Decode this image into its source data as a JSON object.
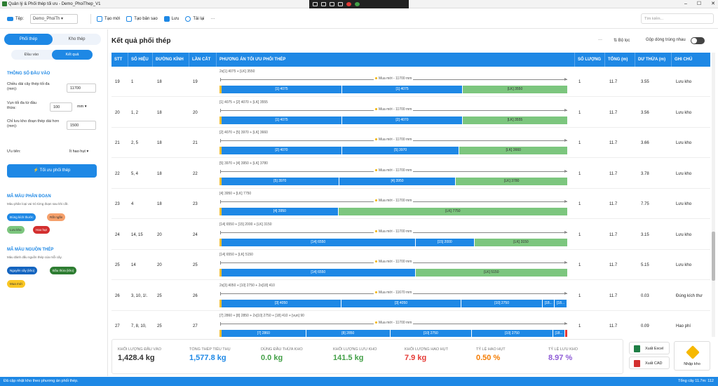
{
  "window": {
    "title": "Quản lý & Phối thép tối ưu - Demo_PhoiThep_V1"
  },
  "toolbar": {
    "file_label": "Tệp:",
    "file_value": "Demo_PhoiTh",
    "new": "Tạo mới",
    "copy": "Tạo bản sao",
    "save": "Lưu",
    "reload": "Tải lại",
    "more": "···",
    "search_placeholder": "Tìm kiếm..."
  },
  "sidebar": {
    "tab_phoi": "Phối thép",
    "tab_kho": "Kho thép",
    "sub_input": "Đầu vào",
    "sub_result": "Kết quả",
    "params_title": "THÔNG SỐ ĐẦU VÀO",
    "f1_label": "Chiều dài cây thép tối đa (mm):",
    "f1_value": "11700",
    "f2_label": "Vụn tối đa từ đầu thừa:",
    "f2_value": "100",
    "f2_unit": "mm",
    "f3_label": "Chỉ lưu kho đoạn thép dài hơn (mm):",
    "f3_value": "1500",
    "f4_label": "Ưu tiên:",
    "f4_value": "Ít hao hụt",
    "optimize_btn": "Tối ưu phối thép",
    "seg_title": "MÃ MÀU PHÂN ĐOẠN",
    "seg_note": "Màu phân loại vai trò từng đoạn sau khi cắt.",
    "chip_correct": "Đúng kích thước",
    "chip_short": "Rất ngắn",
    "chip_store": "Lưu kho",
    "chip_loss": "Hao hụt",
    "src_title": "MÃ MÀU NGUỒN THÉP",
    "src_note": "Màu đánh dấu nguồn thép của mỗi cây.",
    "chip_whole": "Nguyên cây (kho)",
    "chip_leftover": "Đầu thừa (kho)",
    "chip_new": "Mua mới"
  },
  "main": {
    "title": "Kết quả phối thép",
    "more": "···",
    "filter": "Bộ lọc",
    "merge": "Gộp dòng trùng nhau"
  },
  "table": {
    "headers": [
      "STT",
      "SỐ HIỆU",
      "ĐƯỜNG KÍNH",
      "LẦN CẮT",
      "PHƯƠNG ÁN TỐI ƯU PHỐI THÉP",
      "SỐ LƯỢNG",
      "TỔNG (m)",
      "DƯ THỪA (m)",
      "GHI CHÚ"
    ],
    "rows": [
      {
        "stt": "19",
        "so_hieu": "1",
        "dk": "18",
        "lan": "19",
        "text": "2x[1] 4075 + [LK] 3550",
        "cap": "Mua mới - 11700 mm",
        "segs": [
          [
            "[1] 4075",
            4075,
            "blue"
          ],
          [
            "[1] 4075",
            4075,
            "blue"
          ],
          [
            "[LK] 3550",
            3550,
            "green"
          ]
        ],
        "sl": "1",
        "tong": "11.7",
        "du": "3.55",
        "note": "Lưu kho"
      },
      {
        "stt": "20",
        "so_hieu": "1, 2",
        "dk": "18",
        "lan": "20",
        "text": "[1] 4075 + [2] 4070 + [LK] 3555",
        "cap": "Mua mới - 11700 mm",
        "segs": [
          [
            "[1] 4075",
            4075,
            "blue"
          ],
          [
            "[2] 4070",
            4070,
            "blue"
          ],
          [
            "[LK] 3555",
            3555,
            "green"
          ]
        ],
        "sl": "1",
        "tong": "11.7",
        "du": "3.56",
        "note": "Lưu kho"
      },
      {
        "stt": "21",
        "so_hieu": "2, 5",
        "dk": "18",
        "lan": "21",
        "text": "[2] 4070 + [5] 3970 + [LK] 3660",
        "cap": "Mua mới - 11700 mm",
        "segs": [
          [
            "[2] 4070",
            4070,
            "blue"
          ],
          [
            "[5] 3970",
            3970,
            "blue"
          ],
          [
            "[LK] 3660",
            3660,
            "green"
          ]
        ],
        "sl": "1",
        "tong": "11.7",
        "du": "3.66",
        "note": "Lưu kho"
      },
      {
        "stt": "22",
        "so_hieu": "5, 4",
        "dk": "18",
        "lan": "22",
        "text": "[5] 3970 + [4] 3950 + [LK] 3780",
        "cap": "Mua mới - 11700 mm",
        "segs": [
          [
            "[5] 3970",
            3970,
            "blue"
          ],
          [
            "[4] 3950",
            3950,
            "blue"
          ],
          [
            "[LK] 3780",
            3780,
            "green"
          ]
        ],
        "sl": "1",
        "tong": "11.7",
        "du": "3.78",
        "note": "Lưu kho"
      },
      {
        "stt": "23",
        "so_hieu": "4",
        "dk": "18",
        "lan": "23",
        "text": "[4] 3950 + [LK] 7750",
        "cap": "Mua mới - 11700 mm",
        "segs": [
          [
            "[4] 3950",
            3950,
            "blue"
          ],
          [
            "[LK] 7750",
            7750,
            "green"
          ]
        ],
        "sl": "1",
        "tong": "11.7",
        "du": "7.75",
        "note": "Lưu kho"
      },
      {
        "stt": "24",
        "so_hieu": "14, 15",
        "dk": "20",
        "lan": "24",
        "text": "[14] 6550 + [15] 2000 + [LK] 3150",
        "cap": "Mua mới - 11700 mm",
        "segs": [
          [
            "[14] 6550",
            6550,
            "blue"
          ],
          [
            "[15] 2000",
            2000,
            "blue"
          ],
          [
            "[LK] 3150",
            3150,
            "green"
          ]
        ],
        "sl": "1",
        "tong": "11.7",
        "du": "3.15",
        "note": "Lưu kho"
      },
      {
        "stt": "25",
        "so_hieu": "14",
        "dk": "20",
        "lan": "25",
        "text": "[14] 6550 + [LK] 5150",
        "cap": "Mua mới - 11700 mm",
        "segs": [
          [
            "[14] 6550",
            6550,
            "blue"
          ],
          [
            "[LK] 5150",
            5150,
            "green"
          ]
        ],
        "sl": "1",
        "tong": "11.7",
        "du": "5.15",
        "note": "Lưu kho"
      },
      {
        "stt": "26",
        "so_hieu": "3, 10, 1!.",
        "dk": "25",
        "lan": "26",
        "text": "2x[3] 4050 + [10] 2750 + 2x[18] 410",
        "cap": "Mua mới - 11670 mm",
        "segs": [
          [
            "[3] 4050",
            4050,
            "blue"
          ],
          [
            "[3] 4050",
            4050,
            "blue"
          ],
          [
            "[10] 2750",
            2750,
            "blue"
          ],
          [
            "[18...",
            410,
            "blue"
          ],
          [
            "[18...",
            410,
            "blue"
          ]
        ],
        "sl": "1",
        "tong": "11.7",
        "du": "0.03",
        "note": "Đúng kích thư"
      },
      {
        "stt": "27",
        "so_hieu": "7, 8, 10,",
        "dk": "25",
        "lan": "27",
        "text": "[7] 2860 + [8] 2850 + 2x[10] 2750 + [18] 410 + [vụn] 90",
        "cap": "Mua mới - 11700 mm",
        "segs": [
          [
            "[7] 2860",
            2860,
            "blue"
          ],
          [
            "[8] 2850",
            2850,
            "blue"
          ],
          [
            "[10] 2750",
            2750,
            "blue"
          ],
          [
            "[10] 2750",
            2750,
            "blue"
          ],
          [
            "[18...",
            410,
            "blue"
          ],
          [
            "",
            90,
            "red"
          ]
        ],
        "sl": "1",
        "tong": "11.7",
        "du": "0.09",
        "note": "Hao phí"
      }
    ]
  },
  "summary": [
    {
      "label": "KHỐI LƯỢNG ĐẦU VÀO",
      "value": "1,428.4 kg",
      "color": "#333333"
    },
    {
      "label": "TỔNG THÉP TIÊU THỤ",
      "value": "1,577.8 kg",
      "color": "#1e88e5"
    },
    {
      "label": "DÙNG ĐẦU THỪA KHO",
      "value": "0.0 kg",
      "color": "#43a047"
    },
    {
      "label": "KHỐI LƯỢNG LƯU KHO",
      "value": "141.5 kg",
      "color": "#43a047"
    },
    {
      "label": "KHỐI LƯỢNG HAO HỤT",
      "value": "7.9 kg",
      "color": "#e53935"
    },
    {
      "label": "TỶ LỆ HAO HỤT",
      "value": "0.50 %",
      "color": "#f57c00"
    },
    {
      "label": "TỶ LỆ LƯU KHO",
      "value": "8.97 %",
      "color": "#8e5bd6"
    }
  ],
  "actions": {
    "excel": "Xuất Excel",
    "cad": "Xuất CAD",
    "import": "Nhập kho"
  },
  "status": {
    "left": "Đã cập nhật kho theo phương án phối thép.",
    "right": "Tổng cây 11.7m: 112"
  }
}
